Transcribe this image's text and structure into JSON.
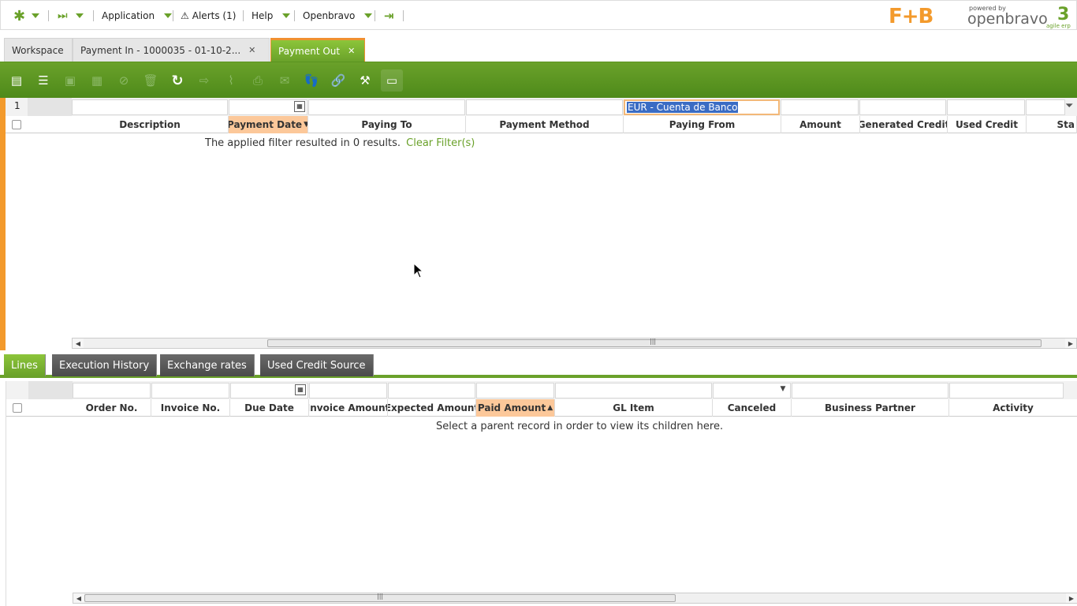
{
  "topbar": {
    "application": "Application",
    "alerts": "Alerts (1)",
    "help": "Help",
    "user": "Openbravo"
  },
  "logo": {
    "text": "F+B",
    "powered": "powered by",
    "brand": "openbravo",
    "version": "3",
    "tag": "agile erp"
  },
  "tabs": [
    {
      "label": "Workspace"
    },
    {
      "label": "Payment In - 1000035 - 01-10-2..."
    },
    {
      "label": "Payment Out"
    }
  ],
  "grid": {
    "row_count": "1",
    "filter_paying_from": "EUR - Cuenta de Banco",
    "columns": [
      "Description",
      "Payment Date",
      "Paying To",
      "Payment Method",
      "Paying From",
      "Amount",
      "Generated Credit",
      "Used Credit",
      "Sta"
    ],
    "sort_column": "Payment Date",
    "empty_message": "The applied filter resulted in 0 results.",
    "clear_filter": "Clear Filter(s)"
  },
  "subtabs": [
    {
      "label": "Lines"
    },
    {
      "label": "Execution History"
    },
    {
      "label": "Exchange rates"
    },
    {
      "label": "Used Credit Source"
    }
  ],
  "lines": {
    "columns": [
      "Order No.",
      "Invoice No.",
      "Due Date",
      "Invoice Amount",
      "Expected Amount",
      "Paid Amount",
      "GL Item",
      "Canceled",
      "Business Partner",
      "Activity"
    ],
    "sort_column": "Paid Amount",
    "empty_message": "Select a parent record in order to view its children here."
  },
  "colors": {
    "accent": "#6aa12a",
    "highlight": "#f39a2c"
  }
}
